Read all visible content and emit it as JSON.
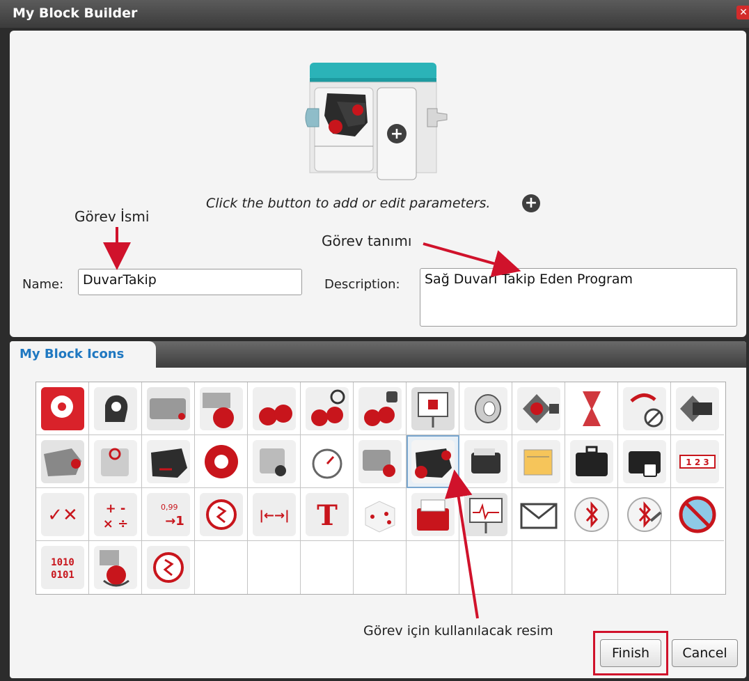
{
  "window": {
    "title": "My Block Builder",
    "close_icon": "close-icon"
  },
  "builder": {
    "hint_text": "Click the button to add or edit parameters.",
    "name_label": "Name:",
    "name_value": "DuvarTakip",
    "description_label": "Description:",
    "description_value": "Sağ Duvarı Takip Eden Program"
  },
  "annotations": {
    "task_name": "Görev İsmi",
    "task_description": "Görev tanımı",
    "task_image": "Görev için kullanılacak resim"
  },
  "icons_tab": {
    "label": "My Block Icons",
    "selected_index": 20,
    "icons": [
      "brain-gears-icon",
      "brain-gears-dark-icon",
      "large-motor-icon",
      "large-motor-red-icon",
      "move-tank-icon",
      "move-steering-icon",
      "motor-control-icon",
      "display-icon",
      "sound-icon",
      "brick-buttons-icon",
      "timer-hourglass-icon",
      "loop-interrupt-icon",
      "brick-icon",
      "ultrasonic-sensor-icon",
      "gyro-sensor-icon",
      "ir-sensor-icon",
      "motor-rotation-icon",
      "medium-motor-icon",
      "stopwatch-icon",
      "color-sensor-icon",
      "ir-sensor-selected-icon",
      "touch-sensor-icon",
      "file-stack-icon",
      "briefcase-icon",
      "locked-briefcase-icon",
      "sequence-123-icon",
      "logic-ops-icon",
      "math-ops-icon",
      "round-icon",
      "random-icon",
      "range-icon",
      "text-icon",
      "dice-icon",
      "file-access-icon",
      "datalog-icon",
      "messaging-icon",
      "bluetooth-icon",
      "bluetooth-settings-icon",
      "no-wireless-icon",
      "binary-icon",
      "motor-invert-icon",
      "unregulated-motor-icon"
    ]
  },
  "buttons": {
    "finish": "Finish",
    "cancel": "Cancel"
  },
  "colors": {
    "accent": "#d0122b",
    "teal": "#2bb3b8",
    "tab_text": "#1f78c1"
  }
}
